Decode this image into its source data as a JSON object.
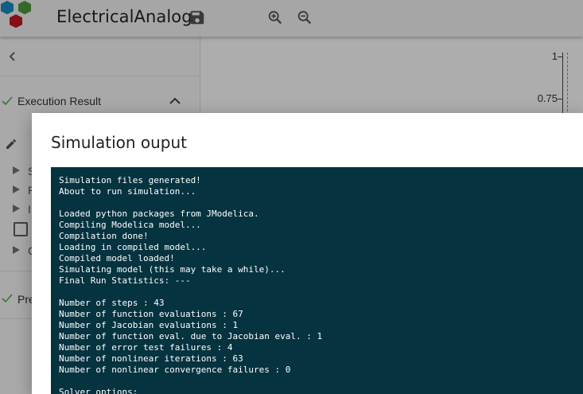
{
  "app": {
    "title": "ElectricalAnalog",
    "colors": {
      "logo_blue": "#1a8dc5",
      "logo_green": "#4e9a3e",
      "logo_red": "#c6181f",
      "accent_green": "#4caf50"
    }
  },
  "toolbar": {
    "icons": [
      "save-icon",
      "zoom-in-icon",
      "zoom-out-icon"
    ]
  },
  "sidebar": {
    "execution_result_label": "Execution Result",
    "tree_items": [
      {
        "label": "S"
      },
      {
        "label": "R"
      },
      {
        "label": "I"
      },
      {
        "label": ""
      },
      {
        "label": "C"
      }
    ],
    "pre_label": "Pre"
  },
  "plot": {
    "y_ticks": [
      "1",
      "0.75"
    ]
  },
  "dialog": {
    "title": "Simulation ouput",
    "console_lines": [
      "Simulation files generated!",
      "About to run simulation...",
      "",
      "Loaded python packages from JModelica.",
      "Compiling Modelica model...",
      "Compilation done!",
      "Loading in compiled model...",
      "Compiled model loaded!",
      "Simulating model (this may take a while)...",
      "Final Run Statistics: ---",
      "",
      "Number of steps : 43",
      "Number of function evaluations : 67",
      "Number of Jacobian evaluations : 1",
      "Number of function eval. due to Jacobian eval. : 1",
      "Number of error test failures : 4",
      "Number of nonlinear iterations : 63",
      "Number of nonlinear convergence failures : 0",
      "",
      "Solver options:"
    ],
    "console_bg": "#053340"
  }
}
